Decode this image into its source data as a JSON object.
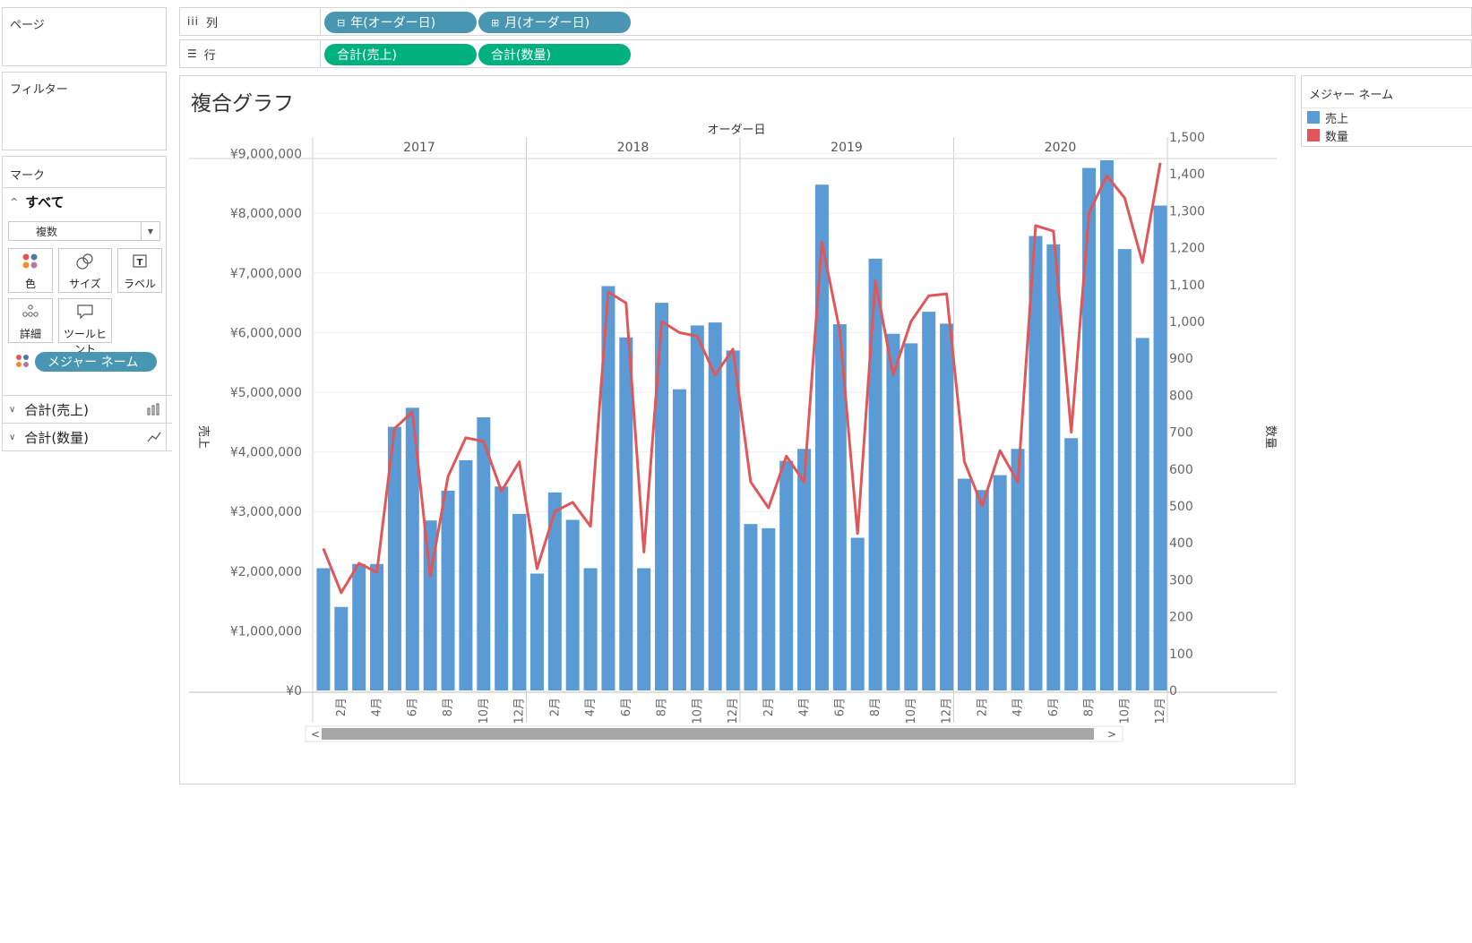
{
  "pages_panel": {
    "title": "ページ"
  },
  "filters_panel": {
    "title": "フィルター"
  },
  "marks_panel": {
    "title": "マーク",
    "all_label": "すべて",
    "mark_type": "複数",
    "buttons": {
      "color": "色",
      "size": "サイズ",
      "label": "ラベル",
      "detail": "詳細",
      "tooltip": "ツールヒント"
    },
    "measure_names_pill": "メジャー ネーム",
    "sections": [
      "合計(売上)",
      "合計(数量)"
    ]
  },
  "shelves": {
    "columns": {
      "label": "列",
      "pills": [
        "年(オーダー日)",
        "月(オーダー日)"
      ]
    },
    "rows": {
      "label": "行",
      "pills": [
        "合計(売上)",
        "合計(数量)"
      ]
    }
  },
  "legend": {
    "title": "メジャー ネーム",
    "items": [
      {
        "label": "売上",
        "color": "#5b9bd5"
      },
      {
        "label": "数量",
        "color": "#e15759"
      }
    ]
  },
  "chart_data": {
    "type": "bar",
    "title": "複合グラフ",
    "column_header": "オーダー日",
    "years": [
      "2017",
      "2018",
      "2019",
      "2020"
    ],
    "month_labels": [
      "2月",
      "4月",
      "6月",
      "8月",
      "10月",
      "12月"
    ],
    "y_left_label": "売上",
    "y_right_label": "数量",
    "y_left_ticks": [
      "¥0",
      "¥1,000,000",
      "¥2,000,000",
      "¥3,000,000",
      "¥4,000,000",
      "¥5,000,000",
      "¥6,000,000",
      "¥7,000,000",
      "¥8,000,000",
      "¥9,000,000"
    ],
    "y_right_ticks": [
      "0",
      "100",
      "200",
      "300",
      "400",
      "500",
      "600",
      "700",
      "800",
      "900",
      "1,000",
      "1,100",
      "1,200",
      "1,300",
      "1,400",
      "1,500"
    ],
    "ylim_left": [
      0,
      9000000
    ],
    "ylim_right": [
      0,
      1450
    ],
    "bar_color": "#5b9bd5",
    "line_color": "#e15759",
    "series": [
      {
        "name": "売上",
        "type": "bar",
        "values": [
          2050000,
          1400000,
          2120000,
          2120000,
          4420000,
          4740000,
          2850000,
          3350000,
          3860000,
          4580000,
          3420000,
          2960000,
          1960000,
          3320000,
          2860000,
          2050000,
          6780000,
          5920000,
          2050000,
          6500000,
          5050000,
          6120000,
          6170000,
          5700000,
          2790000,
          2720000,
          3850000,
          4050000,
          8480000,
          6140000,
          2560000,
          7240000,
          5980000,
          5820000,
          6350000,
          6150000,
          3550000,
          3360000,
          3610000,
          4050000,
          7620000,
          7480000,
          4230000,
          8760000,
          8890000,
          7400000,
          5910000,
          8130000
        ]
      },
      {
        "name": "数量",
        "type": "line",
        "values": [
          385,
          265,
          345,
          320,
          710,
          755,
          310,
          580,
          685,
          675,
          540,
          620,
          330,
          485,
          510,
          445,
          1080,
          1050,
          375,
          1000,
          970,
          960,
          855,
          925,
          565,
          495,
          635,
          565,
          1215,
          975,
          425,
          1110,
          855,
          1000,
          1070,
          1075,
          620,
          500,
          650,
          565,
          1260,
          1245,
          700,
          1295,
          1395,
          1335,
          1160,
          1430
        ]
      }
    ]
  }
}
